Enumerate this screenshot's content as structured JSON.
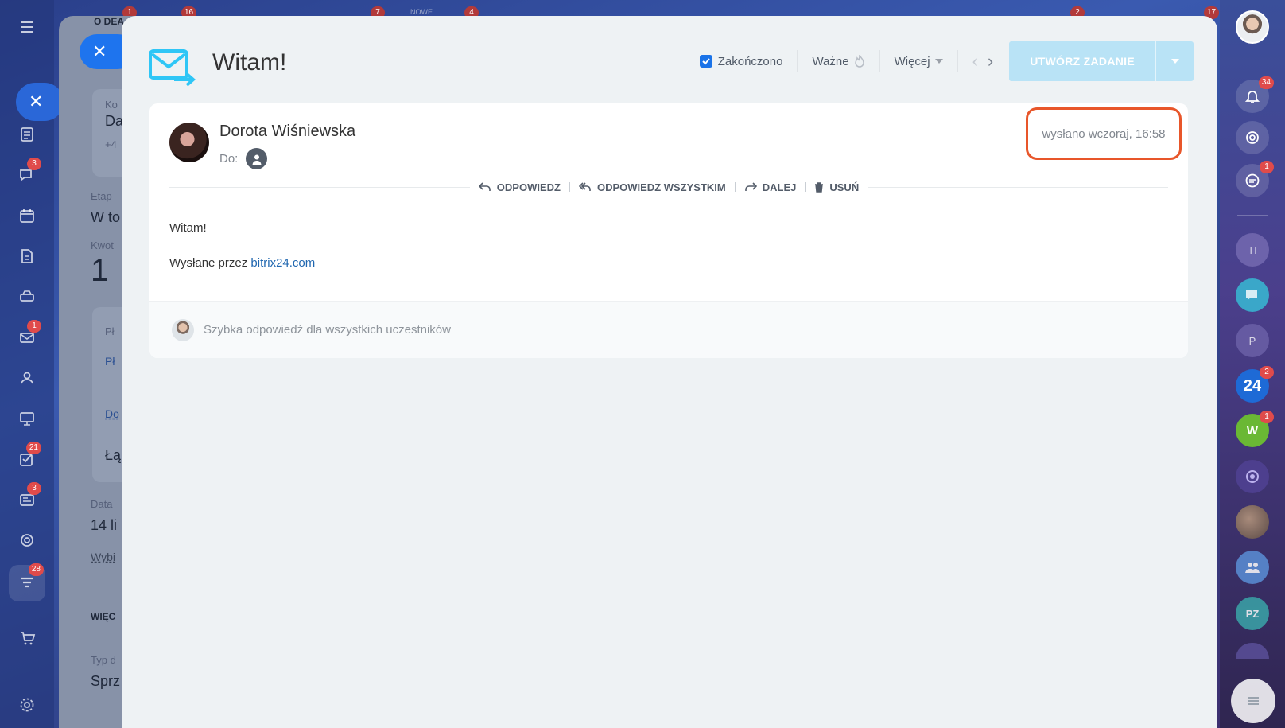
{
  "email": {
    "title": "Witam!",
    "done_label": "Zakończono",
    "important_label": "Ważne",
    "more_label": "Więcej",
    "create_task_label": "UTWÓRZ ZADANIE",
    "sender_name": "Dorota Wiśniewska",
    "to_label": "Do:",
    "sent_time": "wysłano wczoraj, 16:58",
    "actions": {
      "reply": "ODPOWIEDZ",
      "reply_all": "ODPOWIEDZ WSZYSTKIM",
      "forward": "DALEJ",
      "delete": "USUŃ"
    },
    "body_greeting": "Witam!",
    "body_sent_via": "Wysłane przez",
    "body_link": "bitrix24.com",
    "quick_reply_placeholder": "Szybka odpowiedź dla wszystkich uczestników"
  },
  "left_sidebar": {
    "badges": {
      "chat": "3",
      "mail": "1",
      "tasks": "21",
      "feed": "3",
      "crm": "28"
    }
  },
  "deal_panel": {
    "header": "O DEA",
    "field_ko": "Ko",
    "field_da": "Da",
    "field_phone": "+4",
    "stage_label": "Etap",
    "stage_value": "W to",
    "amount_label": "Kwot",
    "amount_value": "1",
    "pay_label": "Pł",
    "pay_link": "Pł",
    "do_link": "Do",
    "link_text": "Łą",
    "date_label": "Data",
    "date_value": "14 li",
    "choose_link": "Wybi",
    "more_header": "WIĘC",
    "type_label": "Typ d",
    "type_value": "Sprz"
  },
  "top_strip": {
    "badges": [
      "1",
      "16",
      "7",
      "4",
      "2",
      "17"
    ],
    "new_label": "NOWE"
  },
  "right_bar": {
    "notifications_badge": "34",
    "messages_badge": "1",
    "tl_initials": "TI",
    "p_initials": "P",
    "b24_label": "24",
    "b24_badge": "2",
    "w_label": "W",
    "w_badge": "1",
    "pz_initials": "PZ"
  },
  "colors": {
    "accent": "#1a73e8",
    "highlight_border": "#e8562a",
    "create_button": "#b9e3f6",
    "link": "#2067b0"
  }
}
